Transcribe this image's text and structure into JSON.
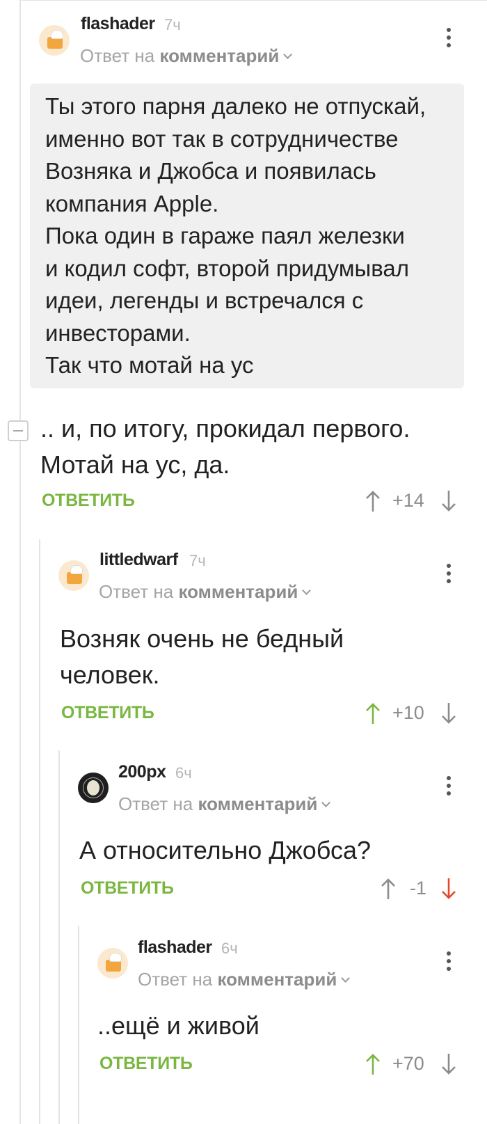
{
  "comments": [
    {
      "username": "flashader",
      "time": "7ч",
      "reply_prefix": "Ответ на",
      "reply_link": "комментарий",
      "quote": "Ты этого парня далеко не отпускай,\nименно вот так в сотрудничестве\nВозняка и Джобса и появилась\nкомпания Apple.\nПока один в гараже паял железки\nи кодил софт, второй придумывал\nидеи, легенды и встречался с\nинвесторами.\nТак что мотай на ус",
      "text_line1": ".. и, по итогу, прокидал первого.",
      "text_line2": "Мотай на ус, да.",
      "reply_label": "ОТВЕТИТЬ",
      "rating": "+14",
      "vote": "none"
    },
    {
      "username": "littledwarf",
      "time": "7ч",
      "reply_prefix": "Ответ на",
      "reply_link": "комментарий",
      "text_line1": "Возняк очень не бедный",
      "text_line2": "человек.",
      "reply_label": "ОТВЕТИТЬ",
      "rating": "+10",
      "vote": "up"
    },
    {
      "username": "200px",
      "time": "6ч",
      "reply_prefix": "Ответ на",
      "reply_link": "комментарий",
      "text_line1": "А относительно Джобса?",
      "reply_label": "ОТВЕТИТЬ",
      "rating": "-1",
      "vote": "down"
    },
    {
      "username": "flashader",
      "time": "6ч",
      "reply_prefix": "Ответ на",
      "reply_link": "комментарий",
      "text_line1": "..ещё и живой",
      "reply_label": "ОТВЕТИТЬ",
      "rating": "+70",
      "vote": "up"
    }
  ],
  "colors": {
    "accent_green": "#7ab640",
    "downvote_red": "#e8452c",
    "neutral_gray": "#8c8c8c",
    "quote_bg": "#f0f0f0"
  },
  "icons": [
    "avatar-chef-icon",
    "avatar-portrait-icon",
    "more-vertical-icon",
    "chevron-down-icon",
    "upvote-arrow-icon",
    "downvote-arrow-icon",
    "collapse-minus-icon"
  ]
}
